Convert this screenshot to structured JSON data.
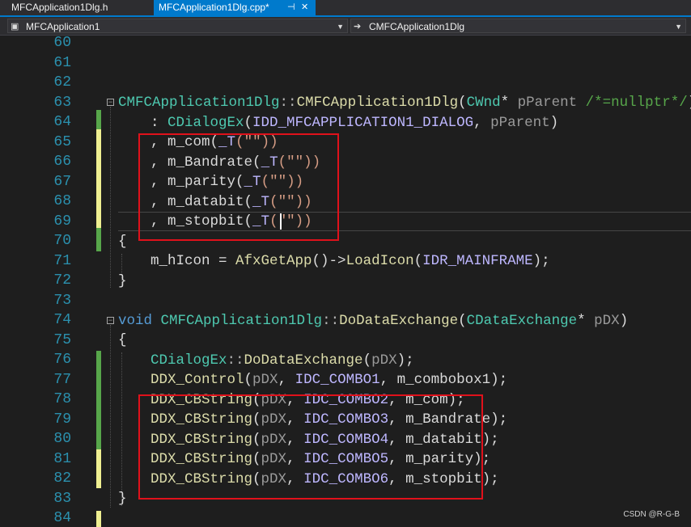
{
  "tabs": [
    {
      "label": "MFCApplication1Dlg.h"
    },
    {
      "label": "MFCApplication1Dlg.cpp*",
      "pin_icon": "pin-icon",
      "close_icon": "close-icon"
    }
  ],
  "navbar": {
    "project": "MFCApplication1",
    "class": "CMFCApplication1Dlg",
    "project_icon": "project-icon",
    "class_icon": "arrow-right-icon"
  },
  "line_numbers": [
    "60",
    "61",
    "62",
    "63",
    "64",
    "65",
    "66",
    "67",
    "68",
    "69",
    "70",
    "71",
    "72",
    "73",
    "74",
    "75",
    "76",
    "77",
    "78",
    "79",
    "80",
    "81",
    "82",
    "83",
    "84"
  ],
  "code": {
    "l63": {
      "cls": "CMFCApplication1Dlg",
      "sep": "::",
      "ctor": "CMFCApplication1Dlg",
      "open": "(",
      "type": "CWnd",
      "star": "* ",
      "param": "pParent",
      "comment": " /*=nullptr*/",
      "close": ")"
    },
    "l64": {
      "colon": ": ",
      "base": "CDialogEx",
      "open": "(",
      "macro": "IDD_MFCAPPLICATION1_DIALOG",
      "comma": ", ",
      "param": "pParent",
      "close": ")"
    },
    "l65": {
      "pre": ", ",
      "member": "m_com",
      "open": "(",
      "macro": "_T",
      "args": "(\"\"))"
    },
    "l66": {
      "pre": ", ",
      "member": "m_Bandrate",
      "open": "(",
      "macro": "_T",
      "args": "(\"\"))"
    },
    "l67": {
      "pre": ", ",
      "member": "m_parity",
      "open": "(",
      "macro": "_T",
      "args": "(\"\"))"
    },
    "l68": {
      "pre": ", ",
      "member": "m_databit",
      "open": "(",
      "macro": "_T",
      "args": "(\"\"))"
    },
    "l69": {
      "pre": ", ",
      "member": "m_stopbit",
      "open": "(",
      "macro": "_T",
      "args": "(\"\"))"
    },
    "l70": {
      "text": "{"
    },
    "l71": {
      "member": "m_hIcon",
      "eq": " = ",
      "fn": "AfxGetApp",
      "call": "()->",
      "method": "LoadIcon",
      "open": "(",
      "macro": "IDR_MAINFRAME",
      "close": ");"
    },
    "l72": {
      "text": "}"
    },
    "l74": {
      "kw": "void",
      "cls": " CMFCApplication1Dlg",
      "sep": "::",
      "fn": "DoDataExchange",
      "open": "(",
      "type": "CDataExchange",
      "star": "* ",
      "param": "pDX",
      "close": ")"
    },
    "l75": {
      "text": "{"
    },
    "l76": {
      "cls": "CDialogEx",
      "sep": "::",
      "fn": "DoDataExchange",
      "open": "(",
      "param": "pDX",
      "close": ");"
    },
    "l77": {
      "fn": "DDX_Control",
      "open": "(",
      "param": "pDX",
      "c1": ", ",
      "macro": "IDC_COMBO1",
      "c2": ", ",
      "member": "m_combobox1",
      "close": ");"
    },
    "l78": {
      "fn": "DDX_CBString",
      "open": "(",
      "param": "pDX",
      "c1": ", ",
      "macro": "IDC_COMBO2",
      "c2": ", ",
      "member": "m_com",
      "close": ");"
    },
    "l79": {
      "fn": "DDX_CBString",
      "open": "(",
      "param": "pDX",
      "c1": ", ",
      "macro": "IDC_COMBO3",
      "c2": ", ",
      "member": "m_Bandrate",
      "close": ");"
    },
    "l80": {
      "fn": "DDX_CBString",
      "open": "(",
      "param": "pDX",
      "c1": ", ",
      "macro": "IDC_COMBO4",
      "c2": ", ",
      "member": "m_databit",
      "close": ");"
    },
    "l81": {
      "fn": "DDX_CBString",
      "open": "(",
      "param": "pDX",
      "c1": ", ",
      "macro": "IDC_COMBO5",
      "c2": ", ",
      "member": "m_parity",
      "close": ");"
    },
    "l82": {
      "fn": "DDX_CBString",
      "open": "(",
      "param": "pDX",
      "c1": ", ",
      "macro": "IDC_COMBO6",
      "c2": ", ",
      "member": "m_stopbit",
      "close": ");"
    },
    "l83": {
      "text": "}"
    }
  },
  "fold_markers": [
    "−",
    "−"
  ],
  "watermark": "CSDN @R-G-B",
  "colors": {
    "background": "#1e1e1e",
    "active_tab": "#007acc",
    "line_number": "#2b91af",
    "highlight_box": "#e0111b",
    "change_saved": "#57a64a",
    "change_unsaved": "#efef91"
  }
}
